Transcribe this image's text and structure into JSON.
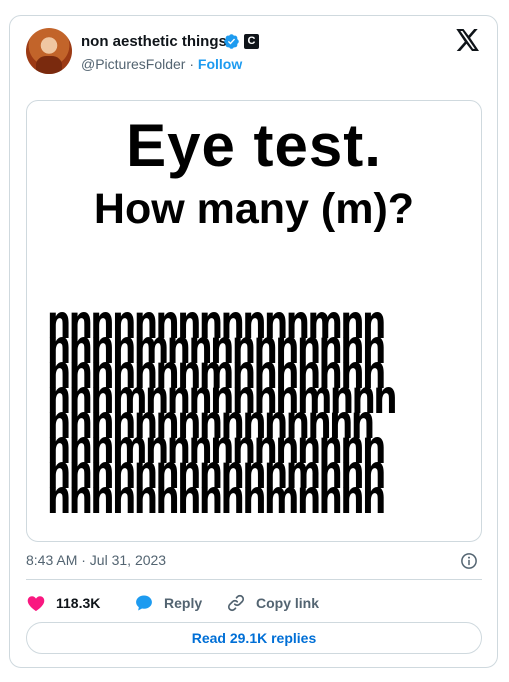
{
  "author": {
    "display_name": "non aesthetic things",
    "handle": "@PicturesFolder",
    "separator": "·",
    "follow_label": "Follow",
    "affiliate_badge": "C"
  },
  "media": {
    "title": "Eye test.",
    "subtitle": "How many (m)?",
    "letter_rows": [
      "nnnnnnnnnnnnmnn",
      "nnnnmnnnnnnnnnn",
      "nnnnnnnmnnnnnnn",
      "nnnmnnnnnnnmnnn",
      "nnnnnnnnnnnnnnn",
      "nnnmnnnnnnnnnnn",
      "nnnnnnnnnnnmnnn",
      "nnnnnnnnnnmnnnn"
    ]
  },
  "meta": {
    "timestamp": "8:43 AM · Jul 31, 2023"
  },
  "actions": {
    "likes": "118.3K",
    "reply_label": "Reply",
    "copy_link_label": "Copy link"
  },
  "replies_button": "Read 29.1K replies",
  "colors": {
    "accent": "#1d9bf0",
    "like": "#f91880",
    "reply_link": "#006fd6",
    "muted": "#536471",
    "border": "#cfd9de"
  },
  "icons": [
    "verified-badge-icon",
    "x-logo-icon",
    "info-icon",
    "heart-icon",
    "reply-bubble-icon",
    "link-icon"
  ]
}
